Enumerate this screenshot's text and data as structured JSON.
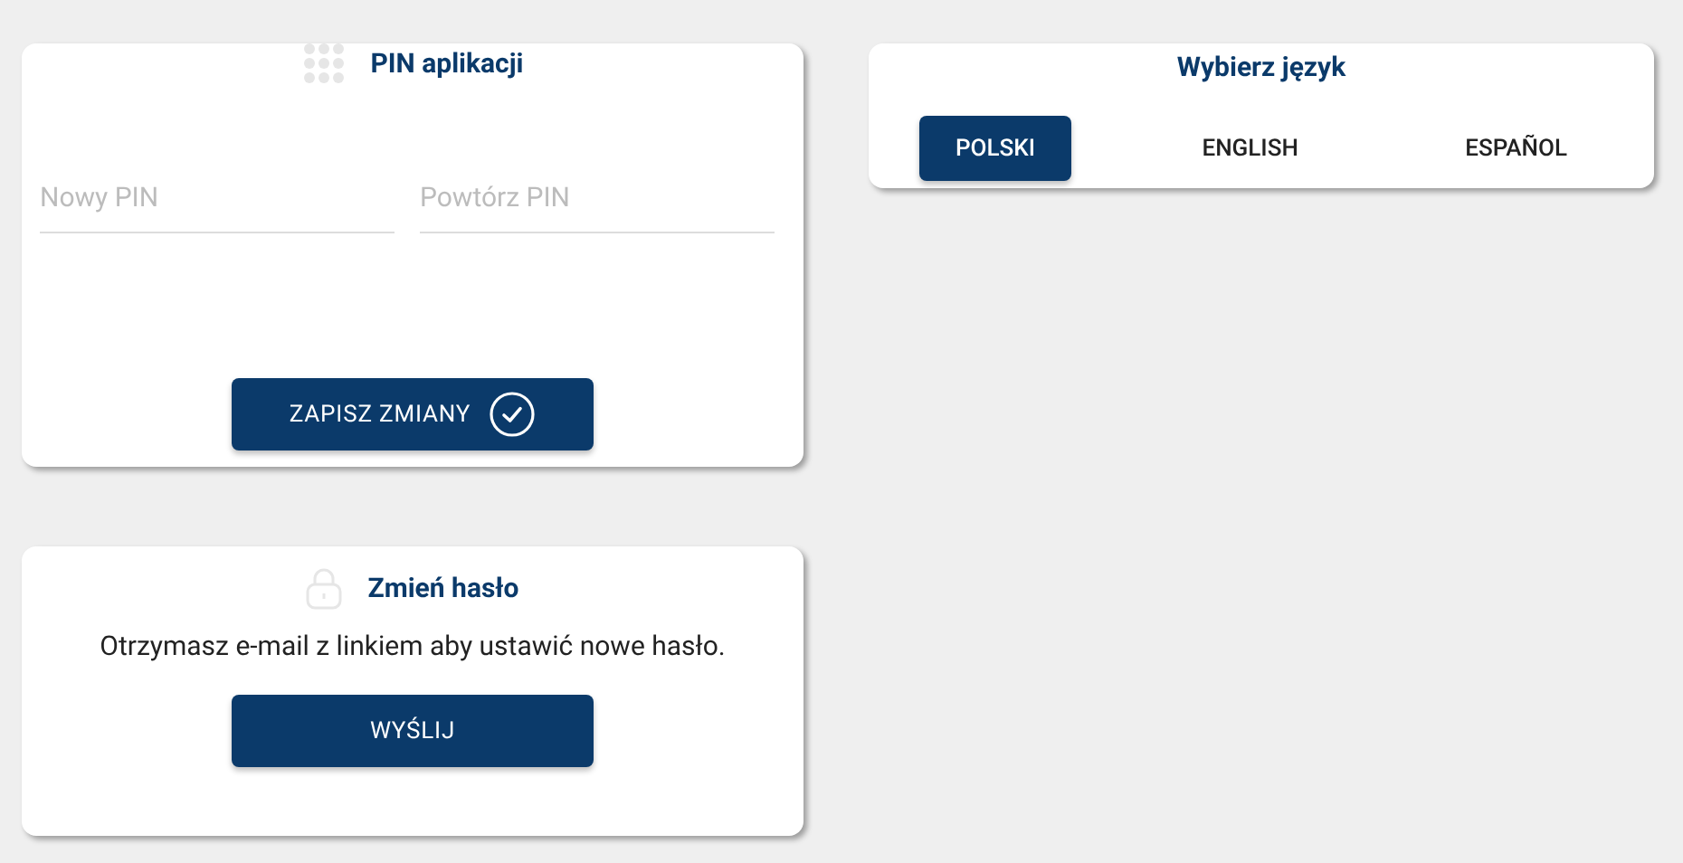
{
  "pin_card": {
    "title": "PIN aplikacji",
    "fields": [
      {
        "placeholder": "Nowy PIN"
      },
      {
        "placeholder": "Powtórz PIN"
      }
    ],
    "button": "ZAPISZ ZMIANY"
  },
  "password_card": {
    "title": "Zmień hasło",
    "text": "Otrzymasz e-mail z linkiem aby ustawić nowe hasło.",
    "button": "WYŚLIJ"
  },
  "language_card": {
    "title": "Wybierz język",
    "options": [
      {
        "label": "POLSKI",
        "selected": true
      },
      {
        "label": "ENGLISH",
        "selected": false
      },
      {
        "label": "ESPAÑOL",
        "selected": false
      }
    ]
  }
}
